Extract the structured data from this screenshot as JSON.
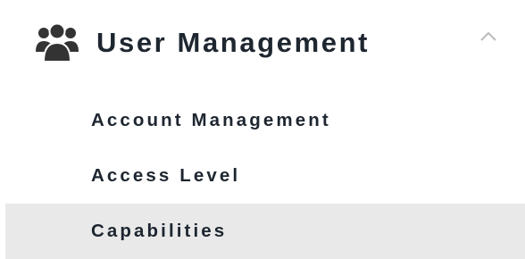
{
  "menu": {
    "section": {
      "title": "User Management",
      "icon": "users-icon",
      "expanded": true,
      "chevron_icon": "chevron-up-icon"
    },
    "items": [
      {
        "label": "Account Management",
        "active": false
      },
      {
        "label": "Access Level",
        "active": false
      },
      {
        "label": "Capabilities",
        "active": true
      }
    ]
  },
  "colors": {
    "text": "#1e2630",
    "icon": "#333333",
    "chevron": "#bbbbbb",
    "active_background": "#e9e9e9"
  }
}
